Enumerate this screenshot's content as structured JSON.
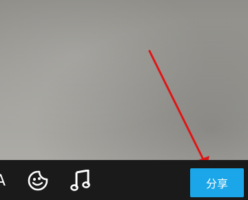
{
  "toolbar": {
    "text_tool_glyph": "A",
    "sticker_icon": "sticker-face-icon",
    "music_icon": "music-note-icon",
    "share_label": "分享"
  },
  "colors": {
    "toolbar_background": "#1a1a1a",
    "share_button": "#1aa6e8",
    "annotation_arrow": "#e01515"
  }
}
